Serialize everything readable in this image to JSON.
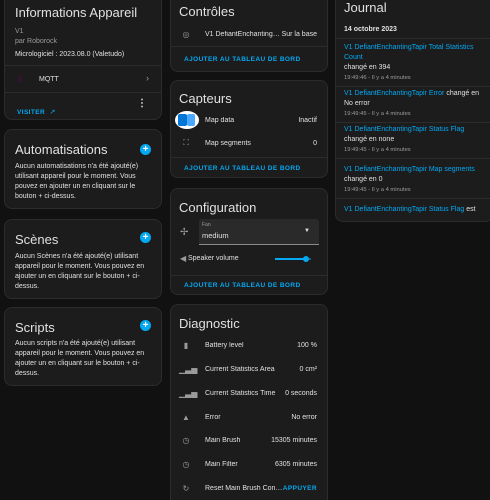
{
  "device": {
    "title": "Informations Appareil",
    "name": "V1",
    "manufacturer": "par Roborock",
    "firmware": "Micrologiciel : 2023.08.0 (Valetudo)",
    "integration": "MQTT",
    "visit_label": "VISITER"
  },
  "automations": {
    "title": "Automatisations",
    "text": "Aucun automatisations n'a été ajouté(e) utilisant appareil pour le moment. Vous pouvez en ajouter un en cliquant sur le bouton + ci-dessus."
  },
  "scenes": {
    "title": "Scènes",
    "text": "Aucun Scènes n'a été ajouté(e) utilisant appareil pour le moment. Vous pouvez en ajouter un en cliquant sur le bouton + ci-dessus."
  },
  "scripts": {
    "title": "Scripts",
    "text": "Aucun scripts n'a été ajouté(e) utilisant appareil pour le moment. Vous pouvez en ajouter un en cliquant sur le bouton + ci-dessus."
  },
  "controls": {
    "title": "Contrôles",
    "entity": "V1 DefiantEnchantingT...",
    "state": "Sur la base",
    "add_label": "AJOUTER AU TABLEAU DE BORD"
  },
  "sensors": {
    "title": "Capteurs",
    "items": [
      {
        "label": "Map data",
        "value": "Inactif"
      },
      {
        "label": "Map segments",
        "value": "0"
      }
    ],
    "add_label": "AJOUTER AU TABLEAU DE BORD"
  },
  "configuration": {
    "title": "Configuration",
    "fan_label": "Fan",
    "fan_value": "medium",
    "speaker_label": "Speaker volume",
    "speaker_level": 0.85,
    "add_label": "AJOUTER AU TABLEAU DE BORD"
  },
  "diagnostic": {
    "title": "Diagnostic",
    "items": [
      {
        "label": "Battery level",
        "value": "100 %"
      },
      {
        "label": "Current Statistics Area",
        "value": "0 cm²"
      },
      {
        "label": "Current Statistics Time",
        "value": "0 seconds"
      },
      {
        "label": "Error",
        "value": "No error"
      },
      {
        "label": "Main Brush",
        "value": "15305 minutes"
      },
      {
        "label": "Main Filter",
        "value": "6305 minutes"
      },
      {
        "label": "Reset Main Brush Cons...",
        "value": "APPUYER"
      }
    ]
  },
  "journal": {
    "title": "Journal",
    "date": "14 octobre 2023",
    "entries": [
      {
        "link": "V1 DefiantEnchantingTapir Total Statistics Count",
        "text": "changé en 394",
        "time": "19:49:46 - Il y a 4 minutes"
      },
      {
        "link": "V1 DefiantEnchantingTapir Error",
        "text": " changé en No error",
        "time": "19:49:45 - Il y a 4 minutes"
      },
      {
        "link": "V1 DefiantEnchantingTapir Status Flag",
        "text": "changé en none",
        "time": "19:49:45 - Il y a 4 minutes"
      },
      {
        "link": "V1 DefiantEnchantingTapir Map segments",
        "text": "changé en 0",
        "time": "19:49:45 - Il y a 4 minutes"
      },
      {
        "link": "V1 DefiantEnchantingTapir Status Flag",
        "text": " est",
        "time": ""
      }
    ]
  },
  "colors": {
    "accent": "#03a9f4",
    "card": "#1c1c1c",
    "background": "#111111"
  }
}
